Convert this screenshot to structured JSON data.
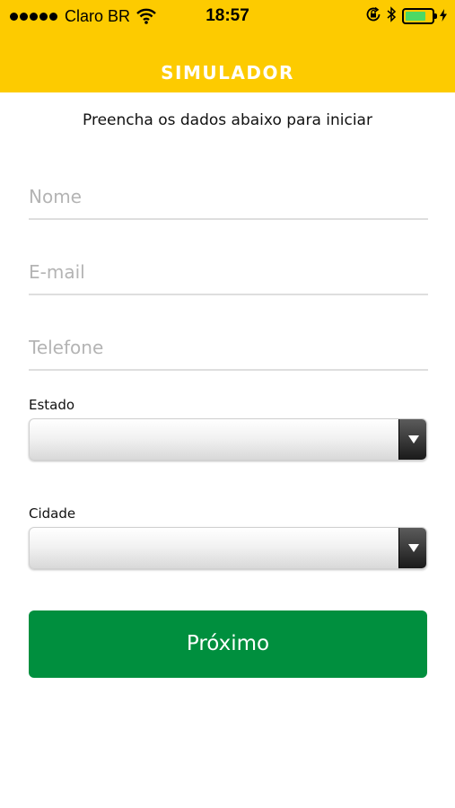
{
  "status_bar": {
    "carrier": "Claro BR",
    "time": "18:57",
    "battery_level": 0.8,
    "icons": [
      "signal-dots-icon",
      "wifi-icon",
      "orientation-lock-icon",
      "bluetooth-icon",
      "battery-icon",
      "charging-bolt-icon"
    ]
  },
  "header": {
    "title": "SIMULADOR",
    "background_color": "#FDCB00"
  },
  "form": {
    "intro": "Preencha os dados abaixo para iniciar",
    "name_placeholder": "Nome",
    "email_placeholder": "E-mail",
    "phone_placeholder": "Telefone",
    "state_label": "Estado",
    "state_value": "",
    "city_label": "Cidade",
    "city_value": "",
    "next_label": "Próximo",
    "next_color": "#008F3E"
  }
}
